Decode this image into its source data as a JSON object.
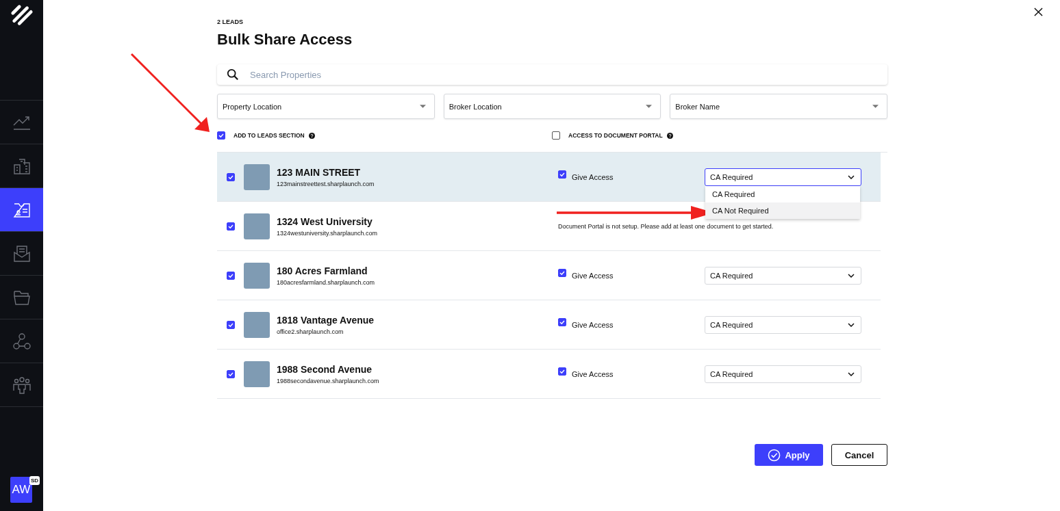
{
  "sidebar": {
    "items": [
      {
        "kind": "chart",
        "selected": false
      },
      {
        "kind": "buildings",
        "selected": false
      },
      {
        "kind": "id-card",
        "selected": true
      },
      {
        "kind": "mail",
        "selected": false
      },
      {
        "kind": "folder",
        "selected": false
      },
      {
        "kind": "network",
        "selected": false
      },
      {
        "kind": "people",
        "selected": false
      }
    ],
    "avatar": {
      "initials": "AW",
      "badge": "SD"
    }
  },
  "dialog": {
    "eyebrow": "2 LEADS",
    "title": "Bulk Share Access",
    "search": {
      "placeholder": "Search Properties"
    },
    "filters": [
      "Property Location",
      "Broker Location",
      "Broker Name"
    ],
    "header": {
      "leads": {
        "label": "ADD TO LEADS SECTION",
        "checked": true
      },
      "portal": {
        "label": "ACCESS TO DOCUMENT PORTAL",
        "checked": false
      }
    },
    "rows": [
      {
        "name": "123 MAIN STREET",
        "url": "123mainstreettest.sharplaunch.com",
        "checked": true,
        "selected": true,
        "access": {
          "kind": "select",
          "label": "Give Access",
          "checked": true,
          "value": "CA Required",
          "expanded": true,
          "options": [
            {
              "label": "CA Required",
              "highlighted": false
            },
            {
              "label": "CA Not Required",
              "highlighted": true
            }
          ]
        }
      },
      {
        "name": "1324 West University",
        "url": "1324westuniversity.sharplaunch.com",
        "checked": true,
        "selected": false,
        "access": {
          "kind": "notice",
          "text": "Document Portal is not setup. Please add at least one document to get started."
        }
      },
      {
        "name": "180 Acres Farmland",
        "url": "180acresfarmland.sharplaunch.com",
        "checked": true,
        "selected": false,
        "access": {
          "kind": "select",
          "label": "Give Access",
          "checked": true,
          "value": "CA Required",
          "expanded": false
        }
      },
      {
        "name": "1818 Vantage Avenue",
        "url": "office2.sharplaunch.com",
        "checked": true,
        "selected": false,
        "access": {
          "kind": "select",
          "label": "Give Access",
          "checked": true,
          "value": "CA Required",
          "expanded": false
        }
      },
      {
        "name": "1988 Second Avenue",
        "url": "1988secondavenue.sharplaunch.com",
        "checked": true,
        "selected": false,
        "access": {
          "kind": "select",
          "label": "Give Access",
          "checked": true,
          "value": "CA Required",
          "expanded": false
        }
      }
    ],
    "buttons": {
      "apply": "Apply",
      "cancel": "Cancel"
    }
  }
}
